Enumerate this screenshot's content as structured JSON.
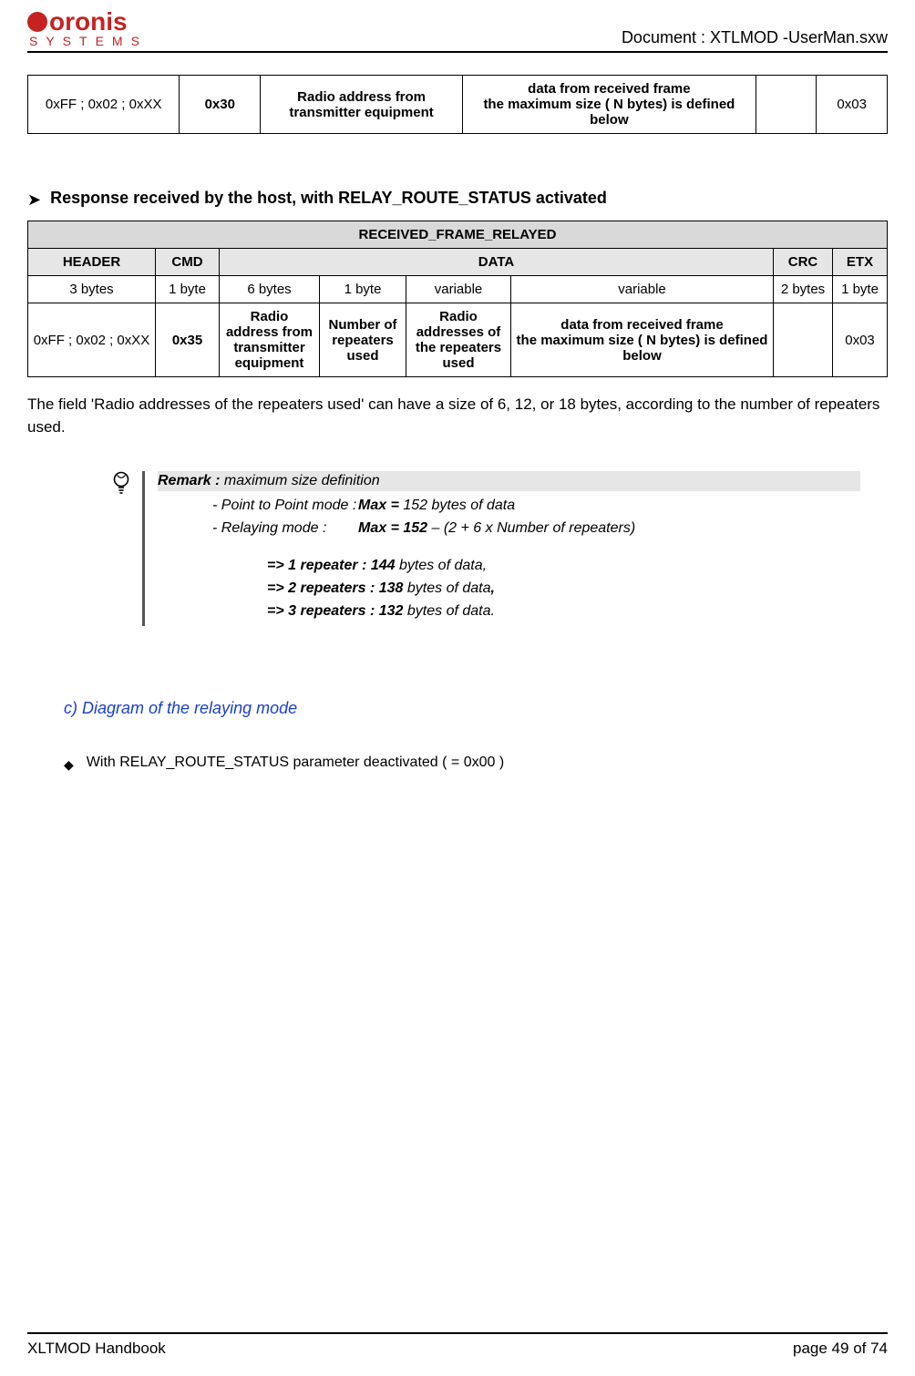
{
  "header": {
    "logo_main": "oronis",
    "logo_sub": "SYSTEMS",
    "document": "Document : XTLMOD -UserMan.sxw"
  },
  "table1": {
    "r": [
      "0xFF ; 0x02 ; 0xXX",
      "0x30",
      "Radio address from transmitter equipment",
      "data from received frame\nthe maximum size  ( N  bytes) is defined below",
      "",
      "0x03"
    ]
  },
  "section2_title": "Response received by the host, with RELAY_ROUTE_STATUS activated",
  "table2": {
    "title": "RECEIVED_FRAME_RELAYED",
    "head": [
      "HEADER",
      "CMD",
      "DATA",
      "CRC",
      "ETX"
    ],
    "sizes": [
      "3 bytes",
      "1 byte",
      "6 bytes",
      "1 byte",
      "variable",
      "variable",
      "2 bytes",
      "1 byte"
    ],
    "vals": [
      "0xFF ; 0x02 ; 0xXX",
      "0x35",
      "Radio address from transmitter equipment",
      "Number of repeaters used",
      "Radio addresses of the repeaters used",
      "data from received frame\nthe maximum size ( N  bytes) is defined below",
      "",
      "0x03"
    ]
  },
  "body_text": "The field 'Radio addresses of the repeaters used' can have a size of 6, 12, or 18 bytes, according to the number of repeaters used.",
  "remark": {
    "label": "Remark :",
    "title_rest": " maximum size definition",
    "l1a": "- Point to Point mode :",
    "l1b_bold": "Max  = ",
    "l1b_rest": "152 bytes of data",
    "l2a": "- Relaying mode  :",
    "l2b_bold": "Max  = 152 ",
    "l2b_rest": "– (2 + 6 x Number of repeaters)",
    "r1_bold": "=> 1 repeater  : 144 ",
    "r1_rest": "bytes of data,",
    "r2_bold": "=> 2 repeaters  : 138 ",
    "r2_rest": "bytes of data",
    "r2_comma": ",",
    "r3_bold": "=> 3 repeaters  : 132 ",
    "r3_rest": "bytes of data."
  },
  "subsection_c": "c) Diagram of the relaying mode",
  "with_line": "With RELAY_ROUTE_STATUS parameter deactivated ( = 0x00 )",
  "footer": {
    "left": "XLTMOD Handbook",
    "right": "page 49 of 74"
  }
}
